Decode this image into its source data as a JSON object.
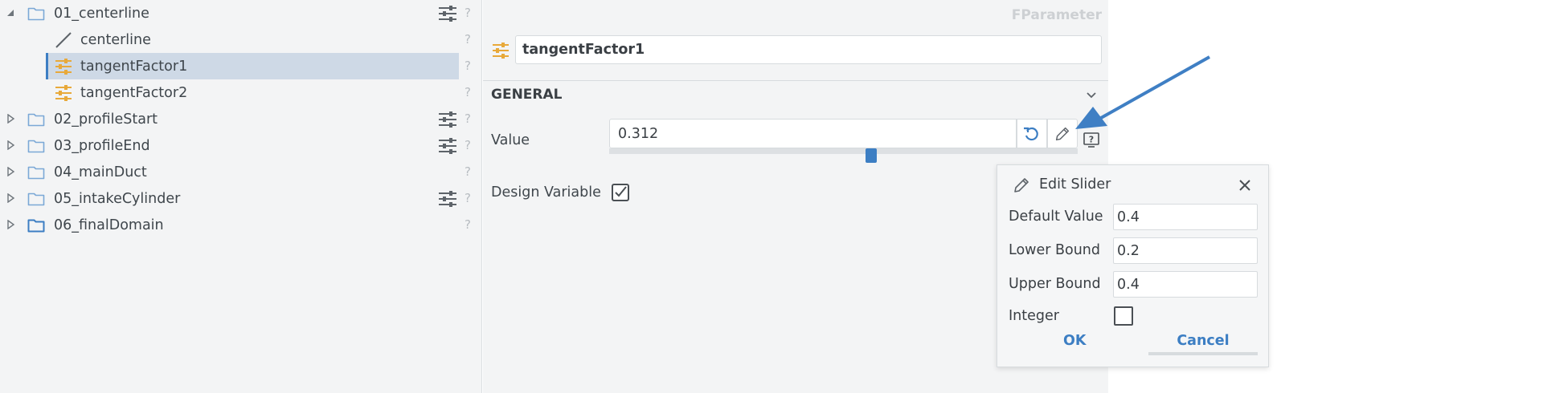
{
  "tree": {
    "items": [
      {
        "label": "01_centerline",
        "expanded": true,
        "icon": "folder-icon"
      },
      {
        "label": "centerline",
        "icon": "line-icon"
      },
      {
        "label": "tangentFactor1",
        "icon": "slider-param-icon",
        "selected": true
      },
      {
        "label": "tangentFactor2",
        "icon": "slider-param-icon"
      },
      {
        "label": "02_profileStart",
        "icon": "folder-icon"
      },
      {
        "label": "03_profileEnd",
        "icon": "folder-icon"
      },
      {
        "label": "04_mainDuct",
        "icon": "folder-icon"
      },
      {
        "label": "05_intakeCylinder",
        "icon": "folder-icon"
      },
      {
        "label": "06_finalDomain",
        "icon": "folder-icon"
      }
    ],
    "help_glyph": "?"
  },
  "props": {
    "type_label": "FParameter",
    "name": "tangentFactor1",
    "section": "GENERAL",
    "value_label": "Value",
    "value": "0.312",
    "slider_fraction": 0.56,
    "design_variable_label": "Design Variable",
    "design_variable_checked": true
  },
  "edit_slider": {
    "title": "Edit Slider",
    "default_value_label": "Default Value",
    "default_value": "0.4",
    "lower_bound_label": "Lower Bound",
    "lower_bound": "0.2",
    "upper_bound_label": "Upper Bound",
    "upper_bound": "0.4",
    "integer_label": "Integer",
    "integer_checked": false,
    "ok_label": "OK",
    "cancel_label": "Cancel"
  },
  "colors": {
    "accent": "#3c7ec3",
    "param_icon": "#e8a93a",
    "selection": "#ced9e6",
    "arrow": "#3f7fc4"
  }
}
